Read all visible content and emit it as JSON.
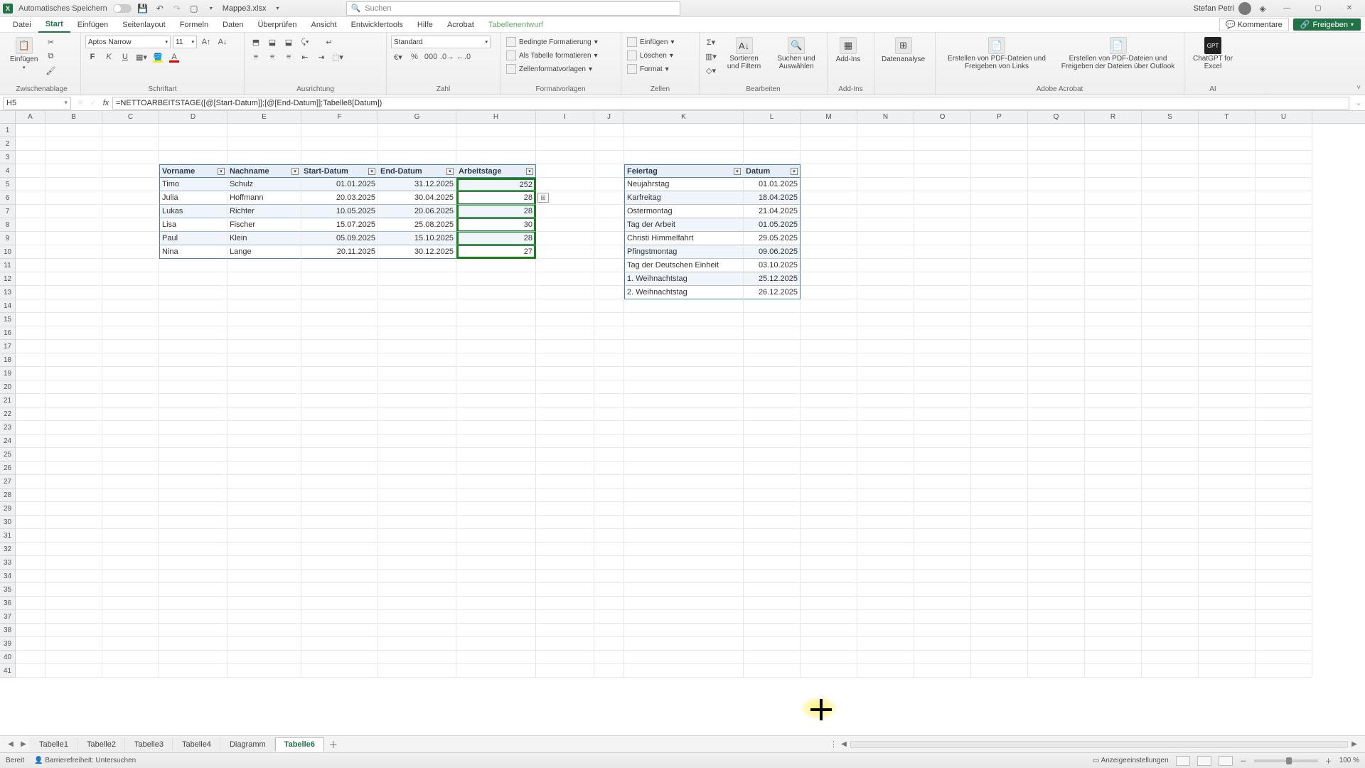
{
  "title": {
    "autosave": "Automatisches Speichern",
    "filename": "Mappe3.xlsx",
    "search_placeholder": "Suchen",
    "user": "Stefan Petri"
  },
  "ribbon_tabs": [
    "Datei",
    "Start",
    "Einfügen",
    "Seitenlayout",
    "Formeln",
    "Daten",
    "Überprüfen",
    "Ansicht",
    "Entwicklertools",
    "Hilfe",
    "Acrobat",
    "Tabellenentwurf"
  ],
  "ribbon_active_tab": "Start",
  "ribbon_right": {
    "comments": "Kommentare",
    "share": "Freigeben"
  },
  "ribbon": {
    "clipboard": {
      "paste": "Einfügen",
      "group": "Zwischenablage"
    },
    "font": {
      "name": "Aptos Narrow",
      "size": "11",
      "group": "Schriftart"
    },
    "align": "Ausrichtung",
    "number": {
      "format": "Standard",
      "group": "Zahl"
    },
    "styles": {
      "cond": "Bedingte Formatierung",
      "astable": "Als Tabelle formatieren",
      "cellstyles": "Zellenformatvorlagen",
      "group": "Formatvorlagen"
    },
    "cells": {
      "insert": "Einfügen",
      "delete": "Löschen",
      "format": "Format",
      "group": "Zellen"
    },
    "editing": {
      "sortfilter": "Sortieren und Filtern",
      "findselect": "Suchen und Auswählen",
      "group": "Bearbeiten"
    },
    "addins": {
      "addins": "Add-Ins",
      "group": "Add-Ins"
    },
    "data": {
      "analysis": "Datenanalyse"
    },
    "acrobat": {
      "pdf1": "Erstellen von PDF-Dateien und Freigeben von Links",
      "pdf2": "Erstellen von PDF-Dateien und Freigeben der Dateien über Outlook",
      "group": "Adobe Acrobat"
    },
    "ai": {
      "chatgpt": "ChatGPT for Excel",
      "group": "AI"
    }
  },
  "formula": {
    "namebox": "H5",
    "formula": "=NETTOARBEITSTAGE([@[Start-Datum]];[@[End-Datum]];Tabelle8[Datum])"
  },
  "columns": [
    "A",
    "B",
    "C",
    "D",
    "E",
    "F",
    "G",
    "H",
    "I",
    "J",
    "K",
    "L",
    "M",
    "N",
    "O",
    "P",
    "Q",
    "R",
    "S",
    "T",
    "U"
  ],
  "table1": {
    "headers": [
      "Vorname",
      "Nachname",
      "Start-Datum",
      "End-Datum",
      "Arbeitstage"
    ],
    "rows": [
      [
        "Timo",
        "Schulz",
        "01.01.2025",
        "31.12.2025",
        "252"
      ],
      [
        "Julia",
        "Hoffmann",
        "20.03.2025",
        "30.04.2025",
        "28"
      ],
      [
        "Lukas",
        "Richter",
        "10.05.2025",
        "20.06.2025",
        "28"
      ],
      [
        "Lisa",
        "Fischer",
        "15.07.2025",
        "25.08.2025",
        "30"
      ],
      [
        "Paul",
        "Klein",
        "05.09.2025",
        "15.10.2025",
        "28"
      ],
      [
        "Nina",
        "Lange",
        "20.11.2025",
        "30.12.2025",
        "27"
      ]
    ]
  },
  "table2": {
    "headers": [
      "Feiertag",
      "Datum"
    ],
    "rows": [
      [
        "Neujahrstag",
        "01.01.2025"
      ],
      [
        "Karfreitag",
        "18.04.2025"
      ],
      [
        "Ostermontag",
        "21.04.2025"
      ],
      [
        "Tag der Arbeit",
        "01.05.2025"
      ],
      [
        "Christi Himmelfahrt",
        "29.05.2025"
      ],
      [
        "Pfingstmontag",
        "09.06.2025"
      ],
      [
        "Tag der Deutschen Einheit",
        "03.10.2025"
      ],
      [
        "1. Weihnachtstag",
        "25.12.2025"
      ],
      [
        "2. Weihnachtstag",
        "26.12.2025"
      ]
    ]
  },
  "sheets": [
    "Tabelle1",
    "Tabelle2",
    "Tabelle3",
    "Tabelle4",
    "Diagramm",
    "Tabelle6"
  ],
  "active_sheet": "Tabelle6",
  "status": {
    "ready": "Bereit",
    "access": "Barrierefreiheit: Untersuchen",
    "display": "Anzeigeeinstellungen",
    "zoom": "100 %"
  }
}
